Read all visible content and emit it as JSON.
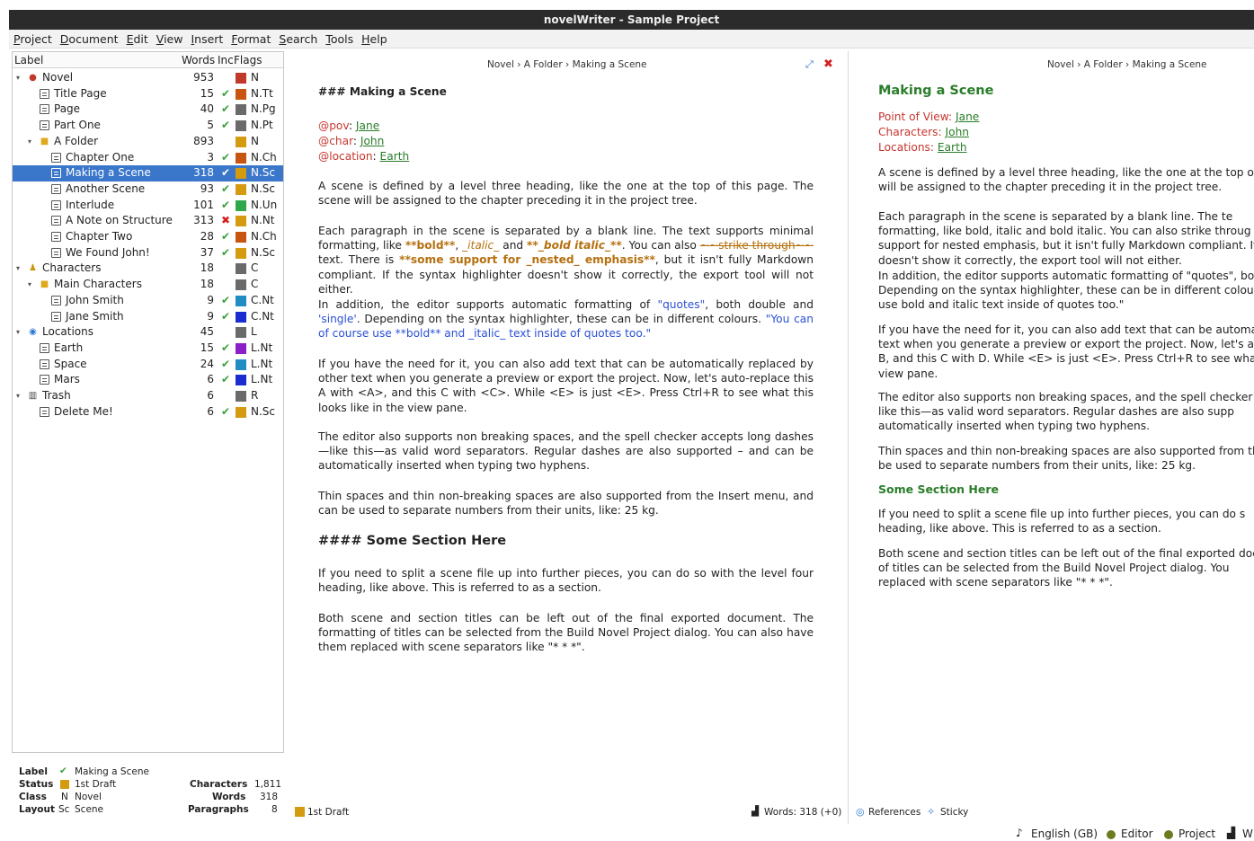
{
  "window": {
    "title": "novelWriter - Sample Project"
  },
  "menu": [
    "Project",
    "Document",
    "Edit",
    "View",
    "Insert",
    "Format",
    "Search",
    "Tools",
    "Help"
  ],
  "tree": {
    "headers": {
      "label": "Label",
      "words": "Words",
      "inc": "Inc",
      "flags": "Flags"
    },
    "rows": [
      {
        "label": "Novel",
        "words": "953",
        "inc": "",
        "color": "#c0392b",
        "flag": "N",
        "depth": 0,
        "icon": "novel-root-icon",
        "twisty": "▾"
      },
      {
        "label": "Title Page",
        "words": "15",
        "inc": "✔",
        "color": "#c8550f",
        "flag": "N.Tt",
        "depth": 1,
        "icon": "document-icon"
      },
      {
        "label": "Page",
        "words": "40",
        "inc": "✔",
        "color": "#6a6a6a",
        "flag": "N.Pg",
        "depth": 1,
        "icon": "document-icon"
      },
      {
        "label": "Part One",
        "words": "5",
        "inc": "✔",
        "color": "#6a6a6a",
        "flag": "N.Pt",
        "depth": 1,
        "icon": "document-icon"
      },
      {
        "label": "A Folder",
        "words": "893",
        "inc": "",
        "color": "#d49a10",
        "flag": "N",
        "depth": 1,
        "icon": "folder-icon",
        "twisty": "▾"
      },
      {
        "label": "Chapter One",
        "words": "3",
        "inc": "✔",
        "color": "#c8550f",
        "flag": "N.Ch",
        "depth": 2,
        "icon": "document-icon"
      },
      {
        "label": "Making a Scene",
        "words": "318",
        "inc": "✔",
        "color": "#d49a10",
        "flag": "N.Sc",
        "depth": 2,
        "icon": "document-icon",
        "selected": true
      },
      {
        "label": "Another Scene",
        "words": "93",
        "inc": "✔",
        "color": "#d49a10",
        "flag": "N.Sc",
        "depth": 2,
        "icon": "document-icon"
      },
      {
        "label": "Interlude",
        "words": "101",
        "inc": "✔",
        "color": "#2ea84a",
        "flag": "N.Un",
        "depth": 2,
        "icon": "document-icon"
      },
      {
        "label": "A Note on Structure",
        "words": "313",
        "inc": "✖",
        "color": "#d49a10",
        "flag": "N.Nt",
        "depth": 2,
        "icon": "document-icon"
      },
      {
        "label": "Chapter Two",
        "words": "28",
        "inc": "✔",
        "color": "#c8550f",
        "flag": "N.Ch",
        "depth": 2,
        "icon": "document-icon"
      },
      {
        "label": "We Found John!",
        "words": "37",
        "inc": "✔",
        "color": "#d49a10",
        "flag": "N.Sc",
        "depth": 2,
        "icon": "document-icon"
      },
      {
        "label": "Characters",
        "words": "18",
        "inc": "",
        "color": "#6a6a6a",
        "flag": "C",
        "depth": 0,
        "icon": "person-icon",
        "twisty": "▾"
      },
      {
        "label": "Main Characters",
        "words": "18",
        "inc": "",
        "color": "#6a6a6a",
        "flag": "C",
        "depth": 1,
        "icon": "folder-icon",
        "twisty": "▾"
      },
      {
        "label": "John Smith",
        "words": "9",
        "inc": "✔",
        "color": "#1f8dc2",
        "flag": "C.Nt",
        "depth": 2,
        "icon": "document-icon"
      },
      {
        "label": "Jane Smith",
        "words": "9",
        "inc": "✔",
        "color": "#1a2bd0",
        "flag": "C.Nt",
        "depth": 2,
        "icon": "document-icon"
      },
      {
        "label": "Locations",
        "words": "45",
        "inc": "",
        "color": "#6a6a6a",
        "flag": "L",
        "depth": 0,
        "icon": "location-pin-icon",
        "twisty": "▾"
      },
      {
        "label": "Earth",
        "words": "15",
        "inc": "✔",
        "color": "#8a1fc9",
        "flag": "L.Nt",
        "depth": 1,
        "icon": "document-icon"
      },
      {
        "label": "Space",
        "words": "24",
        "inc": "✔",
        "color": "#1f8dc2",
        "flag": "L.Nt",
        "depth": 1,
        "icon": "document-icon"
      },
      {
        "label": "Mars",
        "words": "6",
        "inc": "✔",
        "color": "#1a2bd0",
        "flag": "L.Nt",
        "depth": 1,
        "icon": "document-icon"
      },
      {
        "label": "Trash",
        "words": "6",
        "inc": "",
        "color": "#6a6a6a",
        "flag": "R",
        "depth": 0,
        "icon": "trash-icon",
        "twisty": "▾"
      },
      {
        "label": "Delete Me!",
        "words": "6",
        "inc": "✔",
        "color": "#d49a10",
        "flag": "N.Sc",
        "depth": 1,
        "icon": "document-icon"
      }
    ]
  },
  "details": {
    "label_k": "Label",
    "label_v": "Making a Scene",
    "status_k": "Status",
    "status_v": "1st Draft",
    "class_k": "Class",
    "class_code": "N",
    "class_v": "Novel",
    "layout_k": "Layout",
    "layout_code": "Sc",
    "layout_v": "Scene",
    "chars_k": "Characters",
    "chars_v": "1,811",
    "words_k": "Words",
    "words_v": "318",
    "paras_k": "Paragraphs",
    "paras_v": "8",
    "status_color": "#d49a10"
  },
  "editor": {
    "breadcrumb": "Novel › A Folder › Making a Scene",
    "heading": "### Making a Scene",
    "pov_kw": "@pov",
    "pov_v": "Jane",
    "char_kw": "@char",
    "char_v": "John",
    "loc_kw": "@location",
    "loc_v": "Earth",
    "p1": "A scene is defined by a level three heading, like the one at the top of this page. The scene will be assigned to the chapter preceding it in the project tree.",
    "p2a": "Each paragraph in the scene is separated by a blank line. The text supports minimal formatting, like ",
    "p2_bold": "**bold**",
    "p2b": ", ",
    "p2_ital": "_italic_",
    "p2c": " and ",
    "p2_bi": "**_bold italic_**",
    "p2d": ". You can also ",
    "p2_strike": "~~strike through~~",
    "p2e": " text. There is ",
    "p2_nested": "**some support for _nested_ emphasis**",
    "p2f": ", but it isn't fully Markdown compliant. If the syntax highlighter doesn't show it correctly, the export tool will not either.",
    "p3a": "In addition, the editor supports automatic formatting of ",
    "p3_q1": "\"quotes\"",
    "p3b": ", both double and ",
    "p3_q2": "'single'",
    "p3c": ". Depending on the syntax highlighter, these can be in different colours. ",
    "p3_q3": "\"You can of course use **bold** and _italic_ text inside of quotes too.\"",
    "p4": "If you have the need for it, you can also add text that can be automatically replaced by other text when you generate a preview or export the project. Now, let's auto-replace this A with <A>, and this C with <C>.  While <E> is just <E>. Press Ctrl+R to see what this looks like in the view pane.",
    "p5": "The editor also supports non breaking spaces, and the spell checker accepts long dashes—like this—as valid word separators. Regular dashes are also supported – and can be automatically inserted when typing two hyphens.",
    "p6": "Thin spaces and thin non-breaking spaces are also supported from the Insert menu, and can be used to separate numbers from their units, like: 25 kg.",
    "heading2": "#### Some Section Here",
    "p7": "If you need to split a scene file up into further pieces, you can do so with the level four heading, like above. This is referred to as a section.",
    "p8": "Both scene and section titles can be left out of the final exported document. The formatting of titles can be selected from the Build Novel Project dialog. You can also have them replaced with scene separators like \"* * *\".",
    "status_label": "1st Draft",
    "words_label": "Words: 318 (+0)"
  },
  "viewer": {
    "breadcrumb": "Novel › A Folder › Making a Scene",
    "heading": "Making a Scene",
    "pov_k": "Point of View:",
    "pov_v": "Jane",
    "char_k": "Characters:",
    "char_v": "John",
    "loc_k": "Locations:",
    "loc_v": "Earth",
    "l1": "A scene is defined by a level three heading, like the one at the top of",
    "l2": "will be assigned to the chapter preceding it in the project tree.",
    "l3": "Each paragraph in the scene is separated by a blank line. The te",
    "l4": "formatting, like bold, italic and bold italic. You can also strike throug",
    "l5": "support for nested emphasis, but it isn't fully Markdown compliant. If",
    "l6": "doesn't show it correctly, the export tool will not either.",
    "l7": "In addition, the editor supports automatic formatting of \"quotes\", bot",
    "l8": "Depending on the syntax highlighter, these can be in different colour",
    "l9": "use bold and italic text inside of quotes too.\"",
    "l10": "If you have the need for it, you can also add text that can be automatic",
    "l11": "text when you generate a preview or export the project. Now, let's au",
    "l12": "B, and this C with D. While <E> is just <E>. Press Ctrl+R to see wha",
    "l13": "view pane.",
    "l14": "The editor also supports non breaking spaces, and the spell checker a",
    "l15": "like this—as valid word separators. Regular dashes are also supp",
    "l16": "automatically inserted when typing two hyphens.",
    "l17": "Thin spaces and thin non-breaking spaces are also supported from the",
    "l18": "be used to separate numbers from their units, like: 25 kg.",
    "heading2": "Some Section Here",
    "l19": "If you need to split a scene file up into further pieces, you can do s",
    "l20": "heading, like above. This is referred to as a section.",
    "l21": "Both scene and section titles can be left out of the final exported docu",
    "l22": "of titles can be selected from the Build Novel Project dialog. You",
    "l23": "replaced with scene separators like \"* * *\".",
    "references": "References",
    "sticky": "Sticky"
  },
  "statusbar": {
    "language": "English (GB)",
    "editor": "Editor",
    "project": "Project",
    "words": "W"
  }
}
